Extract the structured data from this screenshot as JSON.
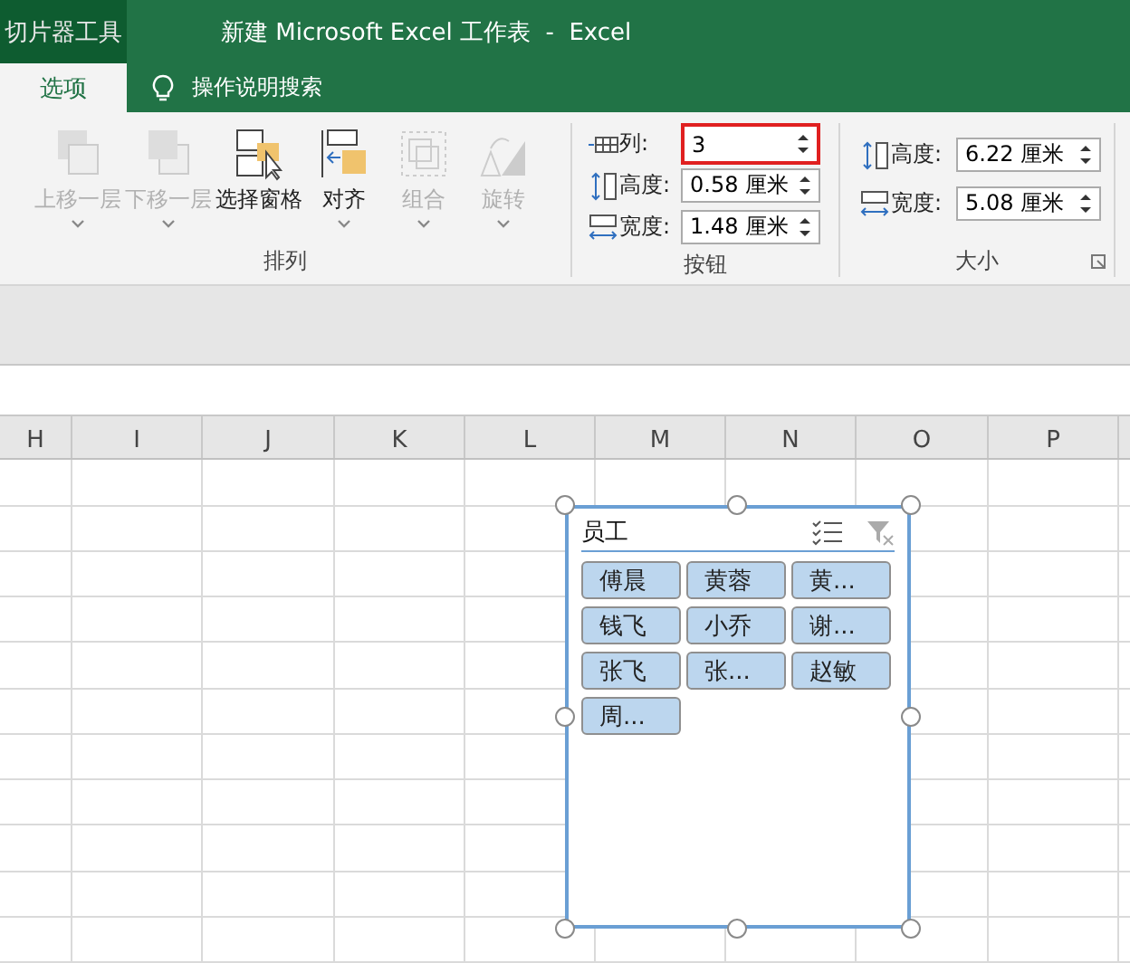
{
  "title_bar": {
    "context_tab": "切片器工具",
    "title": "新建 Microsoft Excel 工作表  -  Excel"
  },
  "tabs": [
    {
      "label": "选项",
      "selected": true
    }
  ],
  "tell_me": {
    "label": "操作说明搜索"
  },
  "arrange_group": {
    "label": "排列",
    "buttons": [
      {
        "kind": "forward",
        "label": "上移一层",
        "disabled": true,
        "dropdown": true
      },
      {
        "kind": "backward",
        "label": "下移一层",
        "disabled": true,
        "dropdown": true
      },
      {
        "kind": "pane",
        "label": "选择窗格",
        "disabled": false,
        "dropdown": false
      },
      {
        "kind": "align",
        "label": "对齐",
        "disabled": false,
        "dropdown": true
      },
      {
        "kind": "group",
        "label": "组合",
        "disabled": true,
        "dropdown": true
      },
      {
        "kind": "rotate",
        "label": "旋转",
        "disabled": true,
        "dropdown": true
      }
    ]
  },
  "buttons_group": {
    "label": "按钮",
    "fields": [
      {
        "kind": "columns",
        "label": "列:",
        "value": "3",
        "highlighted": true
      },
      {
        "kind": "height",
        "label": "高度:",
        "value": "0.58 厘米",
        "highlighted": false
      },
      {
        "kind": "width",
        "label": "宽度:",
        "value": "1.48 厘米",
        "highlighted": false
      }
    ]
  },
  "size_group": {
    "label": "大小",
    "fields": [
      {
        "kind": "height",
        "label": "高度:",
        "value": "6.22 厘米",
        "highlighted": false
      },
      {
        "kind": "width",
        "label": "宽度:",
        "value": "5.08 厘米",
        "highlighted": false
      }
    ]
  },
  "columns": [
    "H",
    "I",
    "J",
    "K",
    "L",
    "M",
    "N",
    "O",
    "P"
  ],
  "slicer": {
    "title": "员工",
    "items": [
      {
        "label": "傅晨",
        "selected": true
      },
      {
        "label": "黄蓉",
        "selected": true
      },
      {
        "label": "黄...",
        "selected": true
      },
      {
        "label": "钱飞",
        "selected": true
      },
      {
        "label": "小乔",
        "selected": true
      },
      {
        "label": "谢...",
        "selected": true
      },
      {
        "label": "张飞",
        "selected": true
      },
      {
        "label": "张...",
        "selected": true
      },
      {
        "label": "赵敏",
        "selected": true
      },
      {
        "label": "周...",
        "selected": true
      }
    ]
  }
}
